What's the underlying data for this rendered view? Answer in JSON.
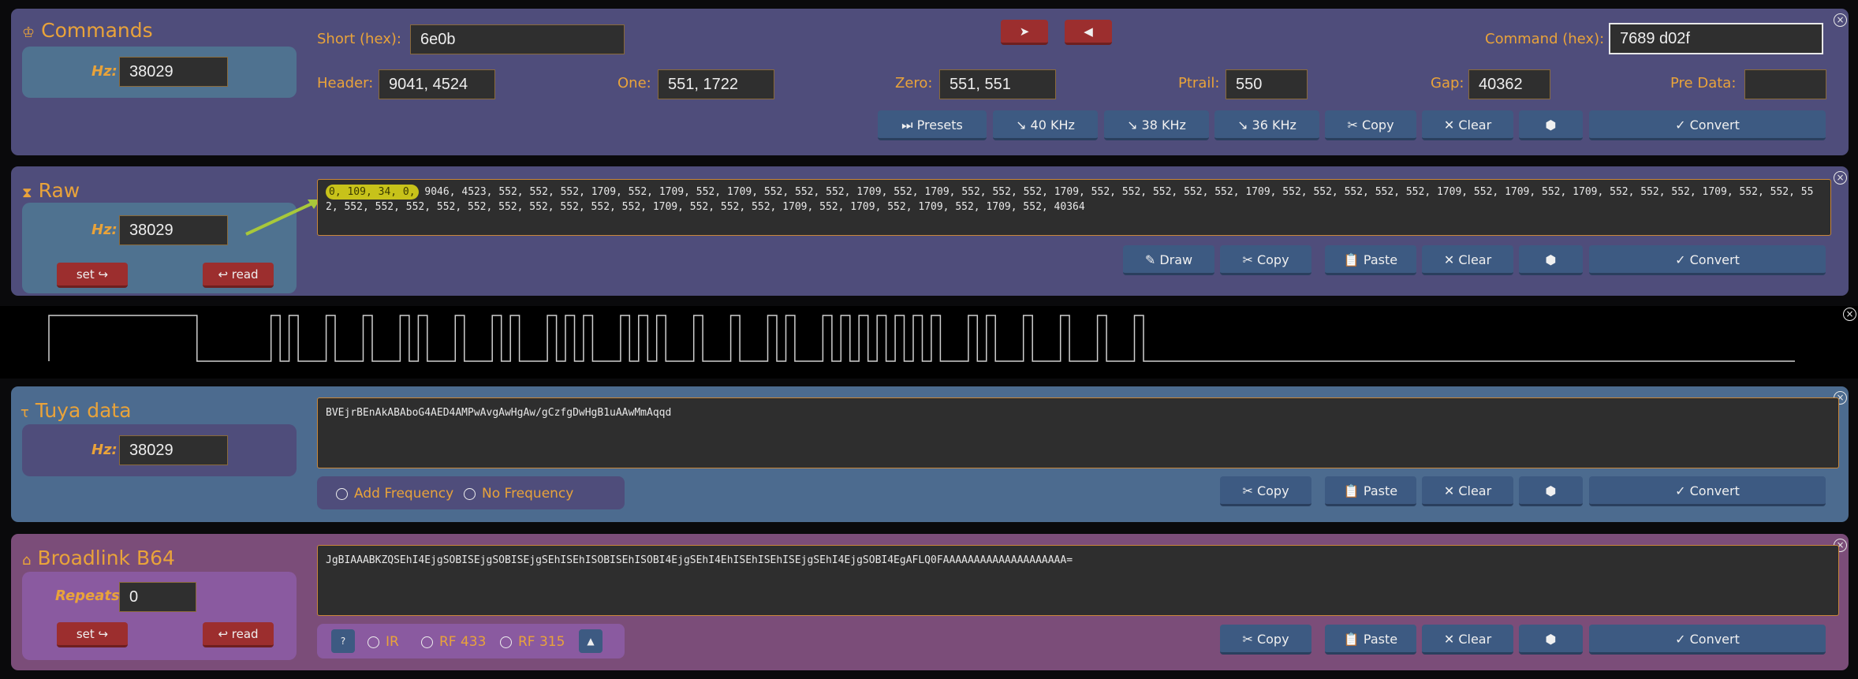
{
  "commands": {
    "title": "Commands",
    "hz_label": "Hz:",
    "hz_value": "38029",
    "short_label": "Short (hex):",
    "short_value": "6e0b",
    "command_label": "Command (hex):",
    "command_value": "7689 d02f",
    "header_label": "Header:",
    "header_value": "9041, 4524",
    "one_label": "One:",
    "one_value": "551, 1722",
    "zero_label": "Zero:",
    "zero_value": "551, 551",
    "ptrail_label": "Ptrail:",
    "ptrail_value": "550",
    "gap_label": "Gap:",
    "gap_value": "40362",
    "predata_label": "Pre Data:",
    "predata_value": "",
    "next_arrow": "➤",
    "prev_arrow": "◀",
    "buttons": {
      "presets": "⏭ Presets",
      "khz40": "↘ 40 KHz",
      "khz38": "↘ 38 KHz",
      "khz36": "↘ 36 KHz",
      "copy": "✂ Copy",
      "clear": "✕ Clear",
      "cube": "⬢",
      "convert": "✓ Convert"
    }
  },
  "raw": {
    "title": "Raw",
    "hz_label": "Hz:",
    "hz_value": "38029",
    "set_label": "set ↪",
    "read_label": "↩ read",
    "highlight": "0, 109, 34, 0,",
    "value": " 9046, 4523, 552, 552, 552, 1709, 552, 1709, 552, 1709, 552, 552, 552, 1709, 552, 1709, 552, 552, 552, 1709, 552, 552, 552, 552, 552, 1709, 552, 552, 552, 552, 552, 1709, 552, 1709, 552, 1709, 552, 552, 552, 1709, 552, 552, 552, 552, 552, 552, 552, 552, 552, 552, 552, 552, 552, 1709, 552, 552, 552, 1709, 552, 1709, 552, 1709, 552, 1709, 552, 40364",
    "buttons": {
      "draw": "✎ Draw",
      "copy": "✂ Copy",
      "paste": "📋 Paste",
      "clear": "✕ Clear",
      "cube": "⬢",
      "convert": "✓ Convert"
    }
  },
  "tuya": {
    "title": "Tuya data",
    "hz_label": "Hz:",
    "hz_value": "38029",
    "value": "BVEjrBEnAkABAboG4AED4AMPwAvgAwHgAw/gCzfgDwHgB1uAAwMmAqqd",
    "add_freq": "Add Frequency",
    "no_freq": "No Frequency",
    "buttons": {
      "copy": "✂ Copy",
      "paste": "📋 Paste",
      "clear": "✕ Clear",
      "cube": "⬢",
      "convert": "✓ Convert"
    }
  },
  "broadlink": {
    "title": "Broadlink B64",
    "repeats_label": "Repeats:",
    "repeats_value": "0",
    "set_label": "set ↪",
    "read_label": "↩ read",
    "value": "JgBIAAABKZQSEhI4EjgSOBISEjgSOBISEjgSEhISEhISOBISEhISOBI4EjgSEhI4EhISEhISEhISEjgSEhI4EjgSOBI4EgAFLQ0FAAAAAAAAAAAAAAAAAAAA=",
    "help": "?",
    "ir": "IR",
    "rf433": "RF 433",
    "rf315": "RF 315",
    "up": "▲",
    "buttons": {
      "copy": "✂ Copy",
      "paste": "📋 Paste",
      "clear": "✕ Clear",
      "cube": "⬢",
      "convert": "✓ Convert"
    }
  },
  "close_icon": "⊗"
}
